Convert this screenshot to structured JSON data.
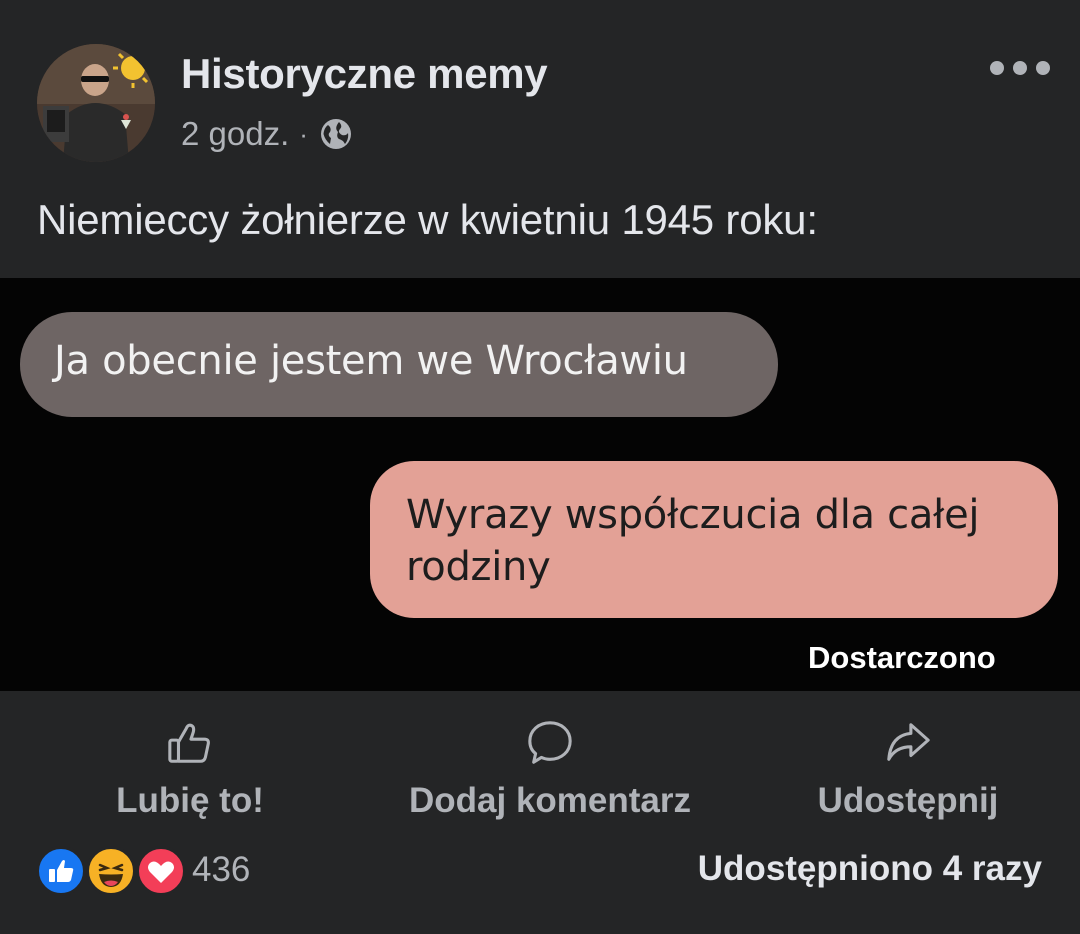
{
  "post": {
    "author": "Historyczne memy",
    "time": "2 godz.",
    "separator": "·",
    "audience_icon": "globe-icon",
    "text": "Niemieccy żołnierze w kwietniu 1945 roku:"
  },
  "meme": {
    "incoming_message": "Ja obecnie jestem we Wrocławiu",
    "outgoing_message": "Wyrazy współczucia dla całej rodziny",
    "status": "Dostarczono"
  },
  "actions": {
    "like_label": "Lubię to!",
    "comment_label": "Dodaj komentarz",
    "share_label": "Udostępnij"
  },
  "footer": {
    "reactions": [
      "like",
      "haha",
      "love"
    ],
    "reaction_count": "436",
    "shares_text": "Udostępniono 4 razy"
  },
  "colors": {
    "background": "#242526",
    "meme_background": "#040404",
    "incoming_bubble": "#6e6564",
    "outgoing_bubble": "#e3a196",
    "like_blue": "#1877f2",
    "love_red": "#f33e58",
    "haha_yellow": "#f7b125"
  }
}
